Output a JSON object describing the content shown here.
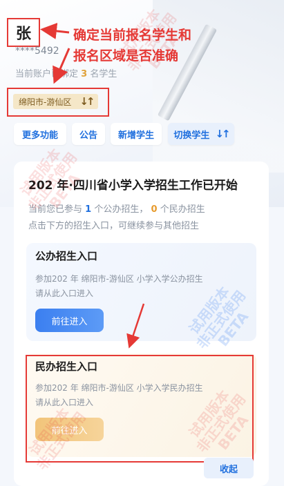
{
  "student": {
    "name": "张",
    "phone": "****5492",
    "bound_prefix": "当前账户已绑定",
    "bound_count": "3",
    "bound_suffix": "名学生"
  },
  "annotation": {
    "line1": "确定当前报名学生和",
    "line2": "报名区域是否准确"
  },
  "region": {
    "label": "绵阳市-游仙区",
    "swap_icon": "swap-vertical-icon"
  },
  "actions": {
    "more": "更多功能",
    "notice": "公告",
    "add_student": "新增学生",
    "switch_student": "切换学生"
  },
  "card": {
    "title": "202  年·四川省小学入学招生工作已开始",
    "info_prefix": "当前您已参与",
    "public_count": "1",
    "info_mid": "个公办招生，",
    "private_count": "0",
    "info_suffix": "个民办招生",
    "info_line2": "点击下方的招生入口，可继续参与其他招生"
  },
  "public_entry": {
    "title": "公办招生入口",
    "desc": "参加202  年 绵阳市-游仙区 小学入学公办招生",
    "hint": "请从此入口进入",
    "button": "前往进入"
  },
  "private_entry": {
    "title": "民办招生入口",
    "desc": "参加202  年 绵阳市-游仙区 小学入学民办招生",
    "hint": "请从此入口进入",
    "button": "前往进入"
  },
  "collapse": "收起",
  "watermark": {
    "line1": "试用版本",
    "line2": "非正式使用",
    "line3": "BETA"
  },
  "colors": {
    "accent": "#1f6fde",
    "annotation": "#e53935",
    "region_bg": "#f5e7c8"
  }
}
